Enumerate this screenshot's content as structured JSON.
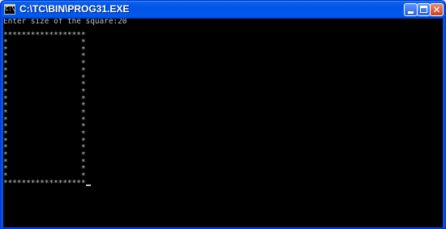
{
  "window": {
    "title": "C:\\TC\\BIN\\PROG31.EXE",
    "icon": "console-icon",
    "buttons": [
      "minimize",
      "maximize",
      "close"
    ],
    "colors": {
      "titlebar": "#0055e5",
      "console_bg": "#000000",
      "console_text": "#c0c0c0"
    }
  },
  "console": {
    "prompt_line": "Enter size of the square:20",
    "blank_line": "",
    "square_top": "******************",
    "square_rows": [
      "*                *",
      "*                *",
      "*                *",
      "*                *",
      "*                *",
      "*                *",
      "*                *",
      "*                *",
      "*                *",
      "*                *",
      "*                *",
      "*                *",
      "*                *",
      "*                *",
      "*                *",
      "*                *",
      "*                *",
      "*                *",
      "*                *",
      "*                *"
    ],
    "square_bottom": "******************"
  }
}
